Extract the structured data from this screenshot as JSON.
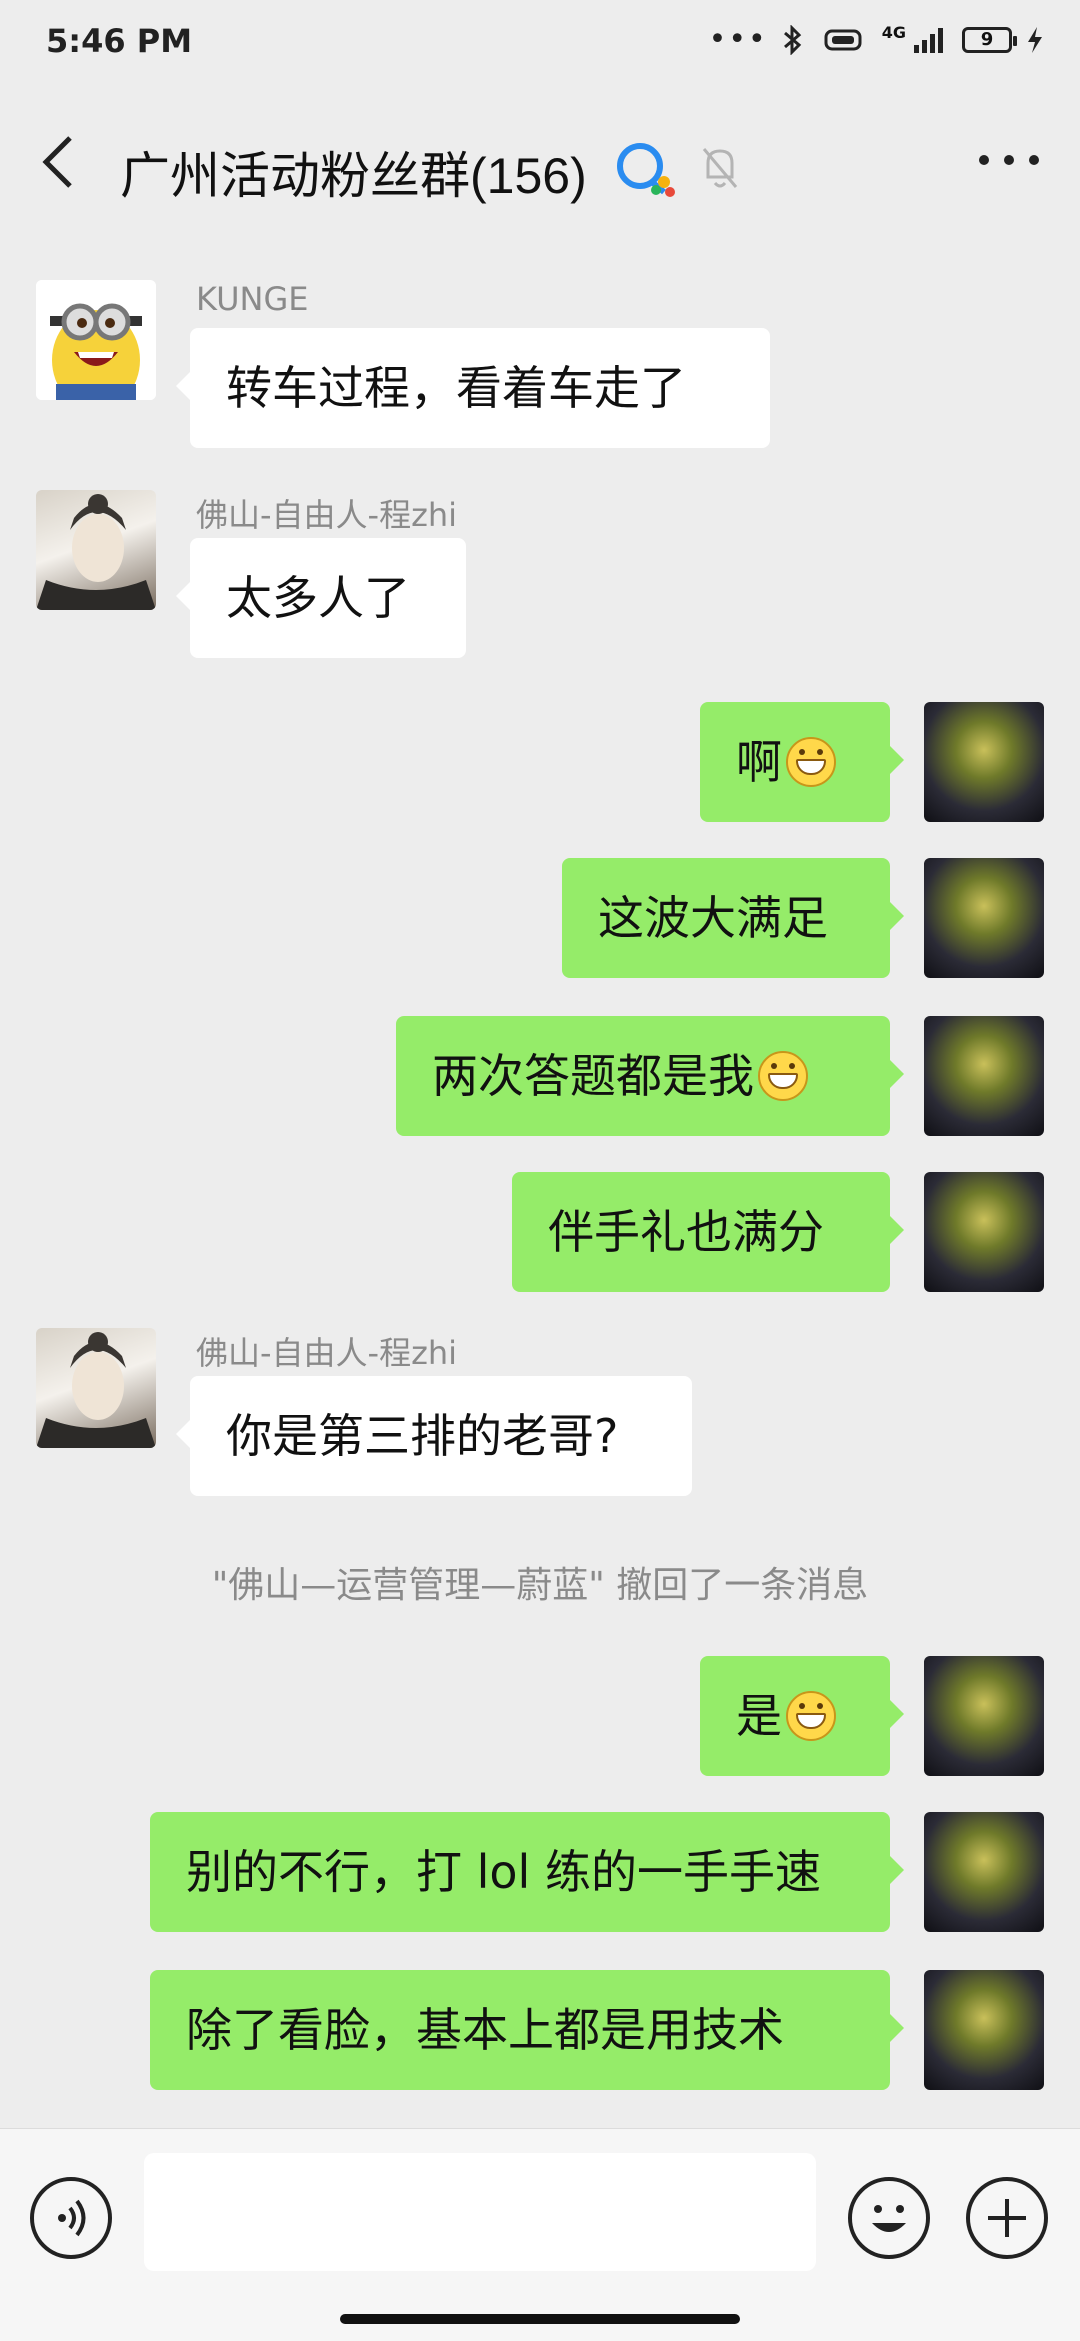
{
  "status_bar": {
    "time": "5:46 PM",
    "network": "4G",
    "battery": "9"
  },
  "header": {
    "title": "广州活动粉丝群(156)"
  },
  "messages": [
    {
      "sender": "KUNGE",
      "text": "转车过程，看着车走了"
    },
    {
      "sender": "佛山-自由人-程zhi",
      "text": "太多人了"
    },
    {
      "text": "啊"
    },
    {
      "text": "这波大满足"
    },
    {
      "text": "两次答题都是我"
    },
    {
      "text": "伴手礼也满分"
    },
    {
      "sender": "佛山-自由人-程zhi",
      "text": "你是第三排的老哥?"
    },
    {
      "text": "是"
    },
    {
      "text": "别的不行，打 lol 练的一手手速"
    },
    {
      "text": "除了看脸，基本上都是用技术"
    }
  ],
  "system_notice": "\"佛山—运营管理—蔚蓝\" 撤回了一条消息",
  "colors": {
    "background": "#ededed",
    "outgoing_bubble": "#95ec69",
    "incoming_bubble": "#ffffff"
  }
}
